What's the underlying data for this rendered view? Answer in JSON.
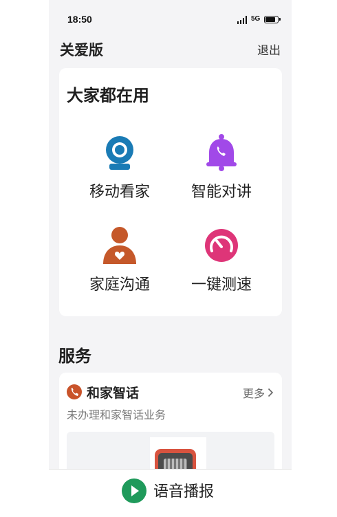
{
  "status_bar": {
    "time": "18:50",
    "network": "5G"
  },
  "header": {
    "title": "关爱版",
    "logout_label": "退出"
  },
  "popular": {
    "title": "大家都在用",
    "items": [
      {
        "label": "移动看家",
        "icon": "camera-icon",
        "color": "#1a7bb5"
      },
      {
        "label": "智能对讲",
        "icon": "bell-phone-icon",
        "color": "#a149e8"
      },
      {
        "label": "家庭沟通",
        "icon": "person-heart-icon",
        "color": "#c5582a"
      },
      {
        "label": "一键测速",
        "icon": "speedometer-icon",
        "color": "#de3578"
      }
    ]
  },
  "services": {
    "title": "服务",
    "card": {
      "name": "和家智话",
      "icon": "phone-icon",
      "more_label": "更多",
      "description": "未办理和家智话业务"
    }
  },
  "bottom_bar": {
    "label": "语音播报",
    "icon": "play-icon"
  }
}
